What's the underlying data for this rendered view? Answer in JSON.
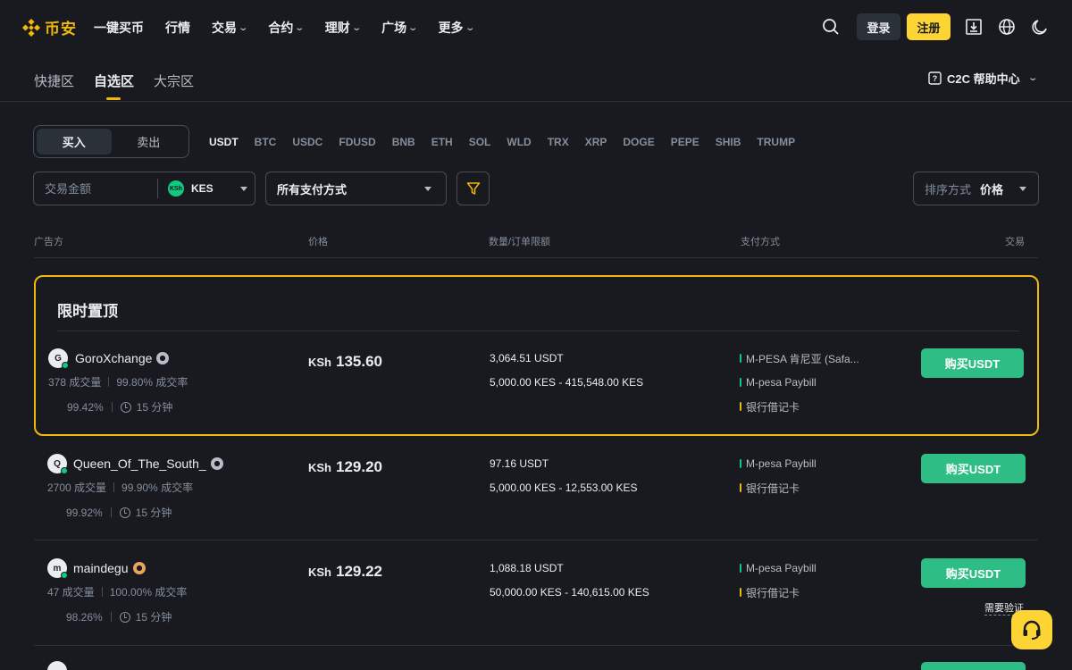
{
  "brand": {
    "name": "币安",
    "color": "#f0b90b"
  },
  "nav": {
    "items": [
      {
        "label": "一键买币",
        "dropdown": false
      },
      {
        "label": "行情",
        "dropdown": false
      },
      {
        "label": "交易",
        "dropdown": true
      },
      {
        "label": "合约",
        "dropdown": true
      },
      {
        "label": "理财",
        "dropdown": true
      },
      {
        "label": "广场",
        "dropdown": true
      },
      {
        "label": "更多",
        "dropdown": true
      }
    ],
    "login": "登录",
    "register": "注册"
  },
  "subtabs": {
    "items": [
      "快捷区",
      "自选区",
      "大宗区"
    ],
    "active": "自选区",
    "help": "C2C 帮助中心"
  },
  "trade_toggle": {
    "buy": "买入",
    "sell": "卖出",
    "active": "买入"
  },
  "coins": [
    "USDT",
    "BTC",
    "USDC",
    "FDUSD",
    "BNB",
    "ETH",
    "SOL",
    "WLD",
    "TRX",
    "XRP",
    "DOGE",
    "PEPE",
    "SHIB",
    "TRUMP"
  ],
  "coin_active": "USDT",
  "filters": {
    "amount_placeholder": "交易金额",
    "currency": "KES",
    "currency_badge": "KSh",
    "payment": "所有支付方式",
    "sort_label": "排序方式",
    "sort_value": "价格"
  },
  "table_header": {
    "advertiser": "广告方",
    "price": "价格",
    "limits": "数量/订单限额",
    "payment": "支付方式",
    "trade": "交易"
  },
  "promo_title": "限时置顶",
  "ads": [
    {
      "avatar": "G",
      "name": "GoroXchange",
      "orders": "378 成交量",
      "completion": "99.80% 成交率",
      "rating": "99.42%",
      "time": "15 分钟",
      "currency_symbol": "KSh",
      "price": "135.60",
      "available": "3,064.51 USDT",
      "limit": "5,000.00 KES - 415,548.00 KES",
      "payments": [
        {
          "name": "M-PESA 肯尼亚 (Safa...",
          "color": "#0ecb81"
        },
        {
          "name": "M-pesa Paybill",
          "color": "#0ecb81"
        },
        {
          "name": "银行借记卡",
          "color": "#f0b90b"
        }
      ],
      "button": "购买USDT",
      "badge_color": "#b7bdc6"
    },
    {
      "avatar": "Q",
      "name": "Queen_Of_The_South_",
      "orders": "2700 成交量",
      "completion": "99.90% 成交率",
      "rating": "99.92%",
      "time": "15 分钟",
      "currency_symbol": "KSh",
      "price": "129.20",
      "available": "97.16 USDT",
      "limit": "5,000.00 KES - 12,553.00 KES",
      "payments": [
        {
          "name": "M-pesa Paybill",
          "color": "#0ecb81"
        },
        {
          "name": "银行借记卡",
          "color": "#f0b90b"
        }
      ],
      "button": "购买USDT",
      "badge_color": "#b7bdc6"
    },
    {
      "avatar": "m",
      "name": "maindegu",
      "orders": "47 成交量",
      "completion": "100.00% 成交率",
      "rating": "98.26%",
      "time": "15 分钟",
      "currency_symbol": "KSh",
      "price": "129.22",
      "available": "1,088.18 USDT",
      "limit": "50,000.00 KES - 140,615.00 KES",
      "payments": [
        {
          "name": "M-pesa Paybill",
          "color": "#0ecb81"
        },
        {
          "name": "银行借记卡",
          "color": "#f0b90b"
        }
      ],
      "button": "购买USDT",
      "badge_color": "#e8a45a"
    }
  ],
  "verify_note": "需要验证",
  "colors": {
    "buy": "#2ebd85",
    "accent": "#fcd535",
    "bg": "#181a20"
  }
}
